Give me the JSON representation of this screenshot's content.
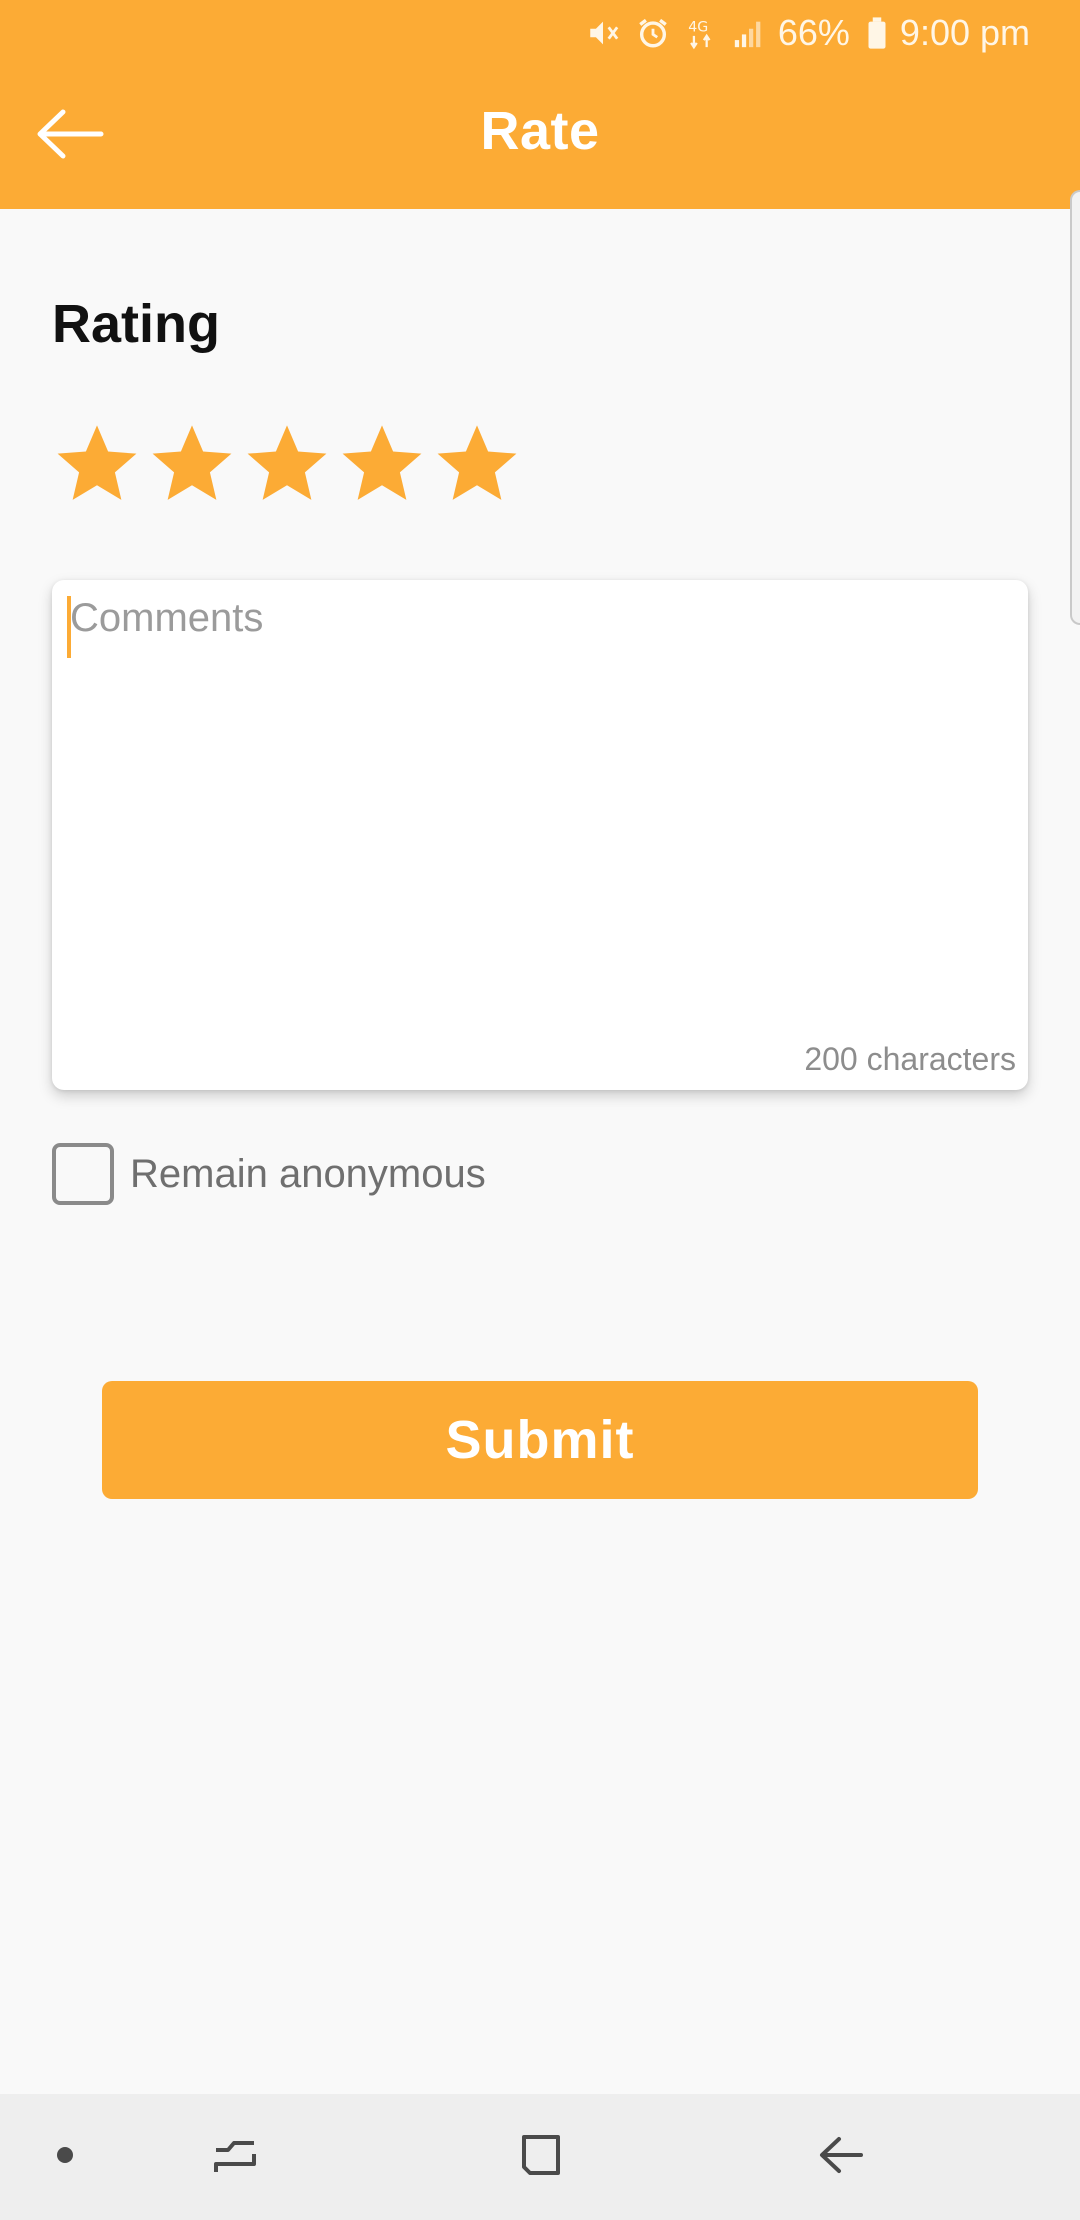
{
  "status_bar": {
    "battery": "66%",
    "time": "9:00 pm",
    "network": "4G",
    "icons": [
      "mute-icon",
      "alarm-icon",
      "network-4g-icon",
      "signal-icon",
      "battery-icon"
    ]
  },
  "header": {
    "title": "Rate",
    "back_icon": "arrow-left-icon"
  },
  "rating": {
    "label": "Rating",
    "value": 5,
    "max": 5
  },
  "comments": {
    "placeholder": "Comments",
    "value": "",
    "counter_text": "200 characters"
  },
  "anonymous": {
    "label": "Remain anonymous",
    "checked": false
  },
  "submit": {
    "label": "Submit"
  },
  "nav_bar": {
    "icons": [
      "dot-icon",
      "recent-apps-icon",
      "home-icon",
      "back-icon"
    ]
  },
  "colors": {
    "accent": "#fcab35",
    "background": "#f9f9f9",
    "nav_background": "#eeeeee"
  }
}
